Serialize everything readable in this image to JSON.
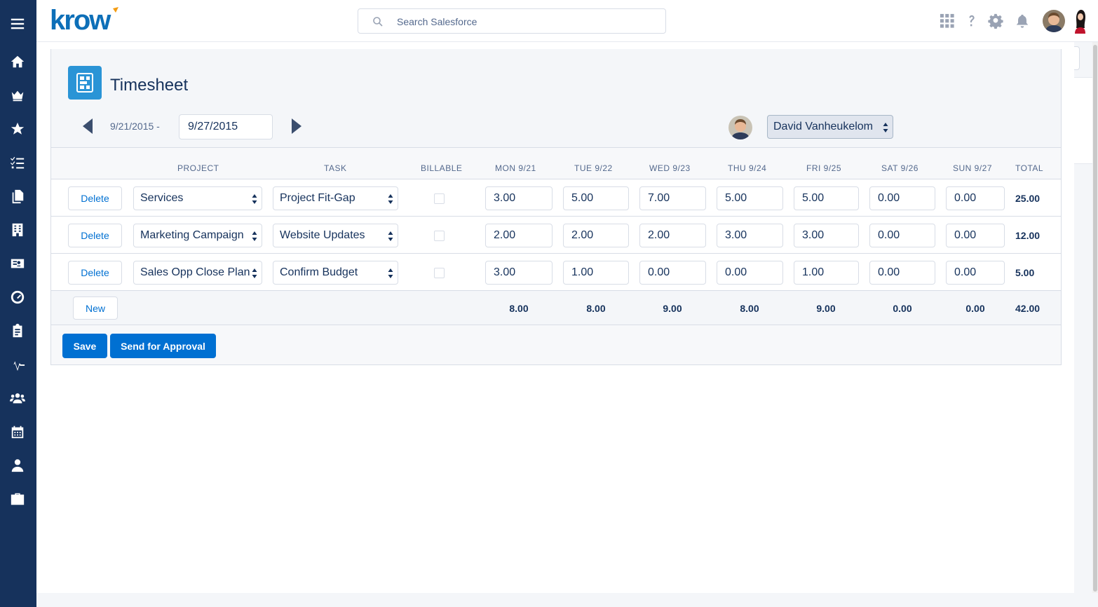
{
  "header": {
    "search_placeholder": "Search Salesforce"
  },
  "page": {
    "title": "Timesheet",
    "date_start": "9/21/2015 -",
    "date_end": "9/27/2015",
    "user_name": "David Vanheukelom"
  },
  "columns": {
    "project": "PROJECT",
    "task": "TASK",
    "billable": "BILLABLE",
    "days": [
      "MON 9/21",
      "TUE 9/22",
      "WED 9/23",
      "THU 9/24",
      "FRI 9/25",
      "SAT 9/26",
      "SUN 9/27"
    ],
    "total": "TOTAL"
  },
  "rows": [
    {
      "delete_label": "Delete",
      "project": "Services",
      "task": "Project Fit-Gap",
      "billable": false,
      "hours": [
        "3.00",
        "5.00",
        "7.00",
        "5.00",
        "5.00",
        "0.00",
        "0.00"
      ],
      "total": "25.00"
    },
    {
      "delete_label": "Delete",
      "project": "Marketing Campaign",
      "task": "Website Updates",
      "billable": false,
      "hours": [
        "2.00",
        "2.00",
        "2.00",
        "3.00",
        "3.00",
        "0.00",
        "0.00"
      ],
      "total": "12.00"
    },
    {
      "delete_label": "Delete",
      "project": "Sales Opp Close Plan",
      "task": "Confirm Budget",
      "billable": false,
      "hours": [
        "3.00",
        "1.00",
        "0.00",
        "0.00",
        "1.00",
        "0.00",
        "0.00"
      ],
      "total": "5.00"
    }
  ],
  "totals": {
    "new_label": "New",
    "days": [
      "8.00",
      "8.00",
      "9.00",
      "8.00",
      "9.00",
      "0.00",
      "0.00"
    ],
    "grand": "42.00"
  },
  "actions": {
    "save_label": "Save",
    "approval_label": "Send for Approval"
  },
  "colors": {
    "nav_bg": "#16325c",
    "brand": "#0070d2",
    "logo": "#0d6fb8",
    "logo_accent": "#f39c12",
    "app_icon": "#2a94d6"
  }
}
